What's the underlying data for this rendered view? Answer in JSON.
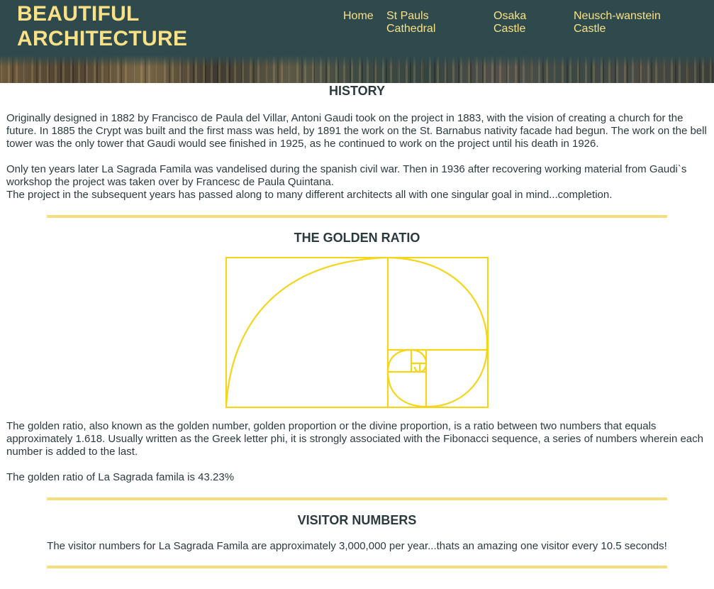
{
  "header": {
    "title_line1": "BEAUTIFUL",
    "title_line2": "ARCHITECTURE",
    "nav": {
      "home": "Home",
      "st_pauls_line1": "St Pauls",
      "st_pauls_line2": "Cathedral",
      "osaka_line1": "Osaka",
      "osaka_line2": "Castle",
      "neusch_line1": "Neusch-wanstein",
      "neusch_line2": "Castle"
    }
  },
  "history": {
    "title": "HISTORY",
    "p1": "Originally designed in 1882 by Francisco de Paula del Villar, Antoni Gaudi took on the project in 1883, with the vision of creating a church for the future. In 1885 the Crypt was built and the first mass was held, by 1891 the work on the St. Barnabus nativity facade had begun. The work on the bell tower was the only tower that Gaudi would see finished in 1925, as he continued to work on the project until his death in 1926.",
    "p2_line1": "Only ten years later La Sagrada Famila was vandelised during the spanish civil war. Then in 1936 after recovering working material from Gaudi`s workshop the project was taken over by Francesc de Paula Quintana.",
    "p2_line2": "The project in the subsequent years has passed along to many different architects all with one singular goal in mind...completion."
  },
  "golden_ratio": {
    "title": "THE GOLDEN RATIO",
    "p1": "The golden ratio, also known as the golden number, golden proportion or the divine proportion, is a ratio between two numbers that equals approximately 1.618. Usually written as the Greek letter phi, it is strongly associated with the Fibonacci sequence, a series of numbers wherein each number is added to the last.",
    "p2": "The golden ratio of La Sagrada famila is 43.23%"
  },
  "visitors": {
    "title": "VISITOR NUMBERS",
    "text": "The visitor numbers for La Sagrada Famila are approximately 3,000,000 per year...thats an amazing one visitor every 10.5 seconds!"
  },
  "colors": {
    "header_bg": "#2e4a4d",
    "accent_yellow": "#fbe186",
    "spiral_yellow": "#f5d51b",
    "divider": "#f8dd7f",
    "text": "#2b3a3d"
  }
}
